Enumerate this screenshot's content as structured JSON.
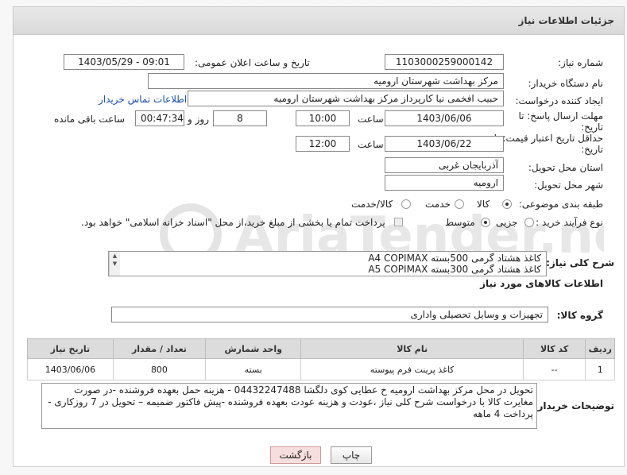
{
  "header": {
    "title": "جزئیات اطلاعات نیاز"
  },
  "fields": {
    "need_number_label": "شماره نیاز:",
    "need_number": "1103000259000142",
    "announce_label": "تاریخ و ساعت اعلان عمومی:",
    "announce_value": "1403/05/29 - 09:01",
    "buyer_org_label": "نام دستگاه خریدار:",
    "buyer_org": "مرکز بهداشت شهرستان ارومیه",
    "creator_label": "ایجاد کننده درخواست:",
    "creator": "حبیب افخمی نیا کارپرداز مرکز بهداشت شهرستان ارومیه",
    "contact_link": "اطلاعات تماس خریدار",
    "deadline_label_1": "مهلت ارسال پاسخ: تا",
    "deadline_label_2": "تاریخ:",
    "deadline_date": "1403/06/06",
    "time_label": "ساعت",
    "deadline_time": "10:00",
    "days_value": "8",
    "days_label": "روز و",
    "remaining_time": "00:47:34",
    "remaining_label": "ساعت باقی مانده",
    "validity_label_1": "حداقل تاریخ اعتبار قیمت: تا",
    "validity_label_2": "تاریخ:",
    "validity_date": "1403/06/22",
    "validity_time": "12:00",
    "province_label": "استان محل تحویل:",
    "province": "آذربایجان غربی",
    "city_label": "شهر محل تحویل:",
    "city": "ارومیه",
    "category_label": "طبقه بندی موضوعی:",
    "category_options": [
      "کالا",
      "خدمت",
      "کالا/خدمت"
    ],
    "purchase_type_label": "نوع فرآیند خرید :",
    "purchase_options": [
      "جزیی",
      "متوسط"
    ],
    "purchase_note": "پرداخت تمام یا بخشی از مبلغ خرید،از محل \"اسناد خزانه اسلامی\" خواهد بود."
  },
  "description": {
    "label": "شرح کلی نیاز:",
    "line1": "کاغذ هشتاد گرمی  500بسته A4 COPIMAX",
    "line2": "کاغذ هشتاد گرمی  300بسته  A5 COPIMAX"
  },
  "goods_section": {
    "title": "اطلاعات کالاهای مورد نیاز",
    "group_label": "گروه کالا:",
    "group_value": "تجهیزات و وسایل تحصیلی واداری"
  },
  "table": {
    "headers": [
      "ردیف",
      "کد کالا",
      "نام کالا",
      "واحد شمارش",
      "تعداد / مقدار",
      "تاریخ نیاز"
    ],
    "rows": [
      {
        "row": "1",
        "code": "--",
        "name": "کاغذ پرینت فرم پیوسته",
        "unit": "بسته",
        "qty": "800",
        "date": "1403/06/06"
      }
    ]
  },
  "buyer_notes": {
    "label": "توضیحات خریدار:",
    "text": "تحویل در محل مرکز بهداشت ارومیه خ عطایی کوی دلگشا 04432247488 - هزینه حمل بعهده فروشنده -در صورت مغایرت کالا با درخواست شرح کلی نیاز ،عودت و هزینه عودت بعهده فروشنده -پیش فاکتور  ضمیمه – تحویل در 7 روزکاری - پرداخت 4 ماهه"
  },
  "buttons": {
    "print": "چاپ",
    "back": "بازگشت"
  },
  "watermark": {
    "text": "AriaTender.neT"
  }
}
